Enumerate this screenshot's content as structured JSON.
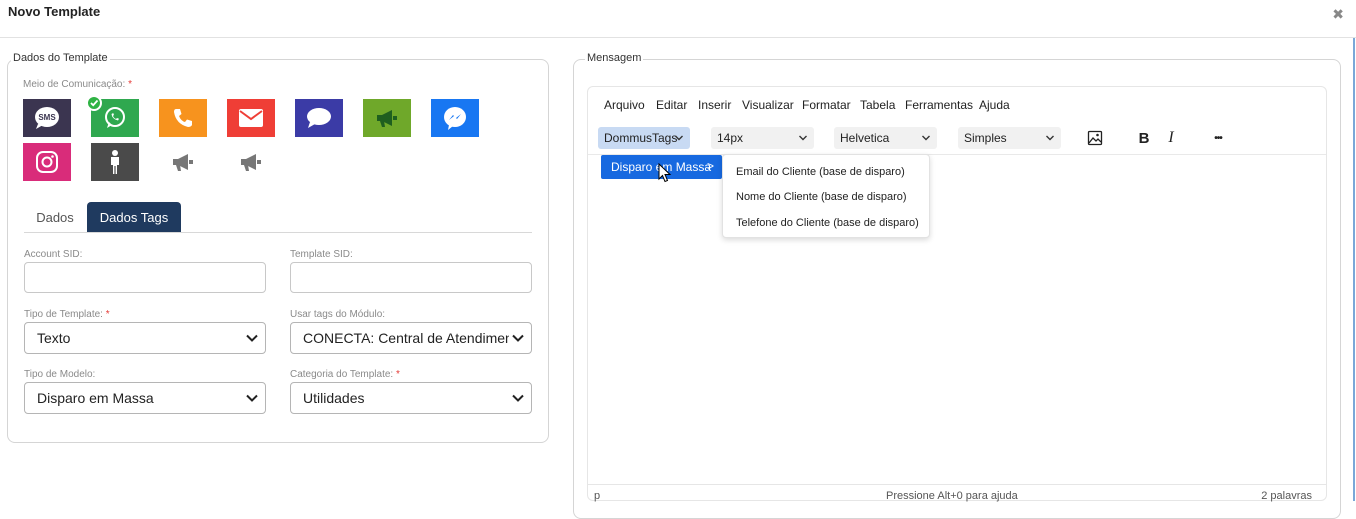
{
  "modal": {
    "title": "Novo Template",
    "close_glyph": "✖"
  },
  "left_panel": {
    "legend": "Dados do Template",
    "channels_label": "Meio de Comunicação:",
    "required_mark": "*",
    "channels": [
      {
        "name": "sms",
        "icon": "sms-icon",
        "bg": "#3b3550",
        "selected": false
      },
      {
        "name": "whatsapp",
        "icon": "whatsapp-icon",
        "bg": "#2fa84f",
        "selected": true
      },
      {
        "name": "phone",
        "icon": "phone-icon",
        "bg": "#f7931e",
        "selected": false
      },
      {
        "name": "email",
        "icon": "email-icon",
        "bg": "#ef3e36",
        "selected": false
      },
      {
        "name": "chat",
        "icon": "chat-icon",
        "bg": "#3b3ba6",
        "selected": false
      },
      {
        "name": "campaign",
        "icon": "megaphone-icon",
        "bg": "#6fa82a",
        "selected": false
      },
      {
        "name": "messenger",
        "icon": "messenger-icon",
        "bg": "#1877f2",
        "selected": false
      },
      {
        "name": "instagram",
        "icon": "instagram-icon",
        "bg": "#d92c7a",
        "selected": false
      },
      {
        "name": "person",
        "icon": "person-icon",
        "bg": "#4a4a4a",
        "selected": false
      },
      {
        "name": "megaphone-gray-1",
        "icon": "megaphone-icon",
        "bg": "#ffffff",
        "selected": false
      },
      {
        "name": "megaphone-gray-2",
        "icon": "megaphone-icon",
        "bg": "#ffffff",
        "selected": false
      }
    ],
    "tabs": [
      {
        "label": "Dados",
        "active": false
      },
      {
        "label": "Dados Tags",
        "active": true
      }
    ],
    "fields": {
      "account_sid": {
        "label": "Account SID:",
        "value": ""
      },
      "template_sid": {
        "label": "Template SID:",
        "value": ""
      },
      "tipo_template": {
        "label": "Tipo de Template:",
        "value": "Texto"
      },
      "usar_tags": {
        "label": "Usar tags do Módulo:",
        "value": "CONECTA: Central de Atendimento"
      },
      "tipo_modelo": {
        "label": "Tipo de Modelo:",
        "value": "Disparo em Massa"
      },
      "categoria": {
        "label": "Categoria do Template:",
        "value": "Utilidades"
      }
    }
  },
  "right_panel": {
    "legend": "Mensagem",
    "menubar": [
      "Arquivo",
      "Editar",
      "Inserir",
      "Visualizar",
      "Formatar",
      "Tabela",
      "Ferramentas",
      "Ajuda"
    ],
    "toolbar": {
      "tags_menu": "DommusTags",
      "font_size": "14px",
      "font_family": "Helvetica",
      "block_format": "Simples",
      "bold": "B",
      "italic": "I",
      "more": "•••"
    },
    "dropdown": {
      "submenu_label": "Disparo em Massa",
      "submenu_arrow": ">",
      "items": [
        "Email do Cliente (base de disparo)",
        "Nome do Cliente (base de disparo)",
        "Telefone do Cliente (base de disparo)"
      ]
    },
    "status": {
      "path": "p",
      "help": "Pressione Alt+0 para ajuda",
      "words": "2 palavras"
    }
  },
  "colors": {
    "accent": "#1769e0",
    "tab_active": "#1f3a5f",
    "required": "#e53935"
  }
}
